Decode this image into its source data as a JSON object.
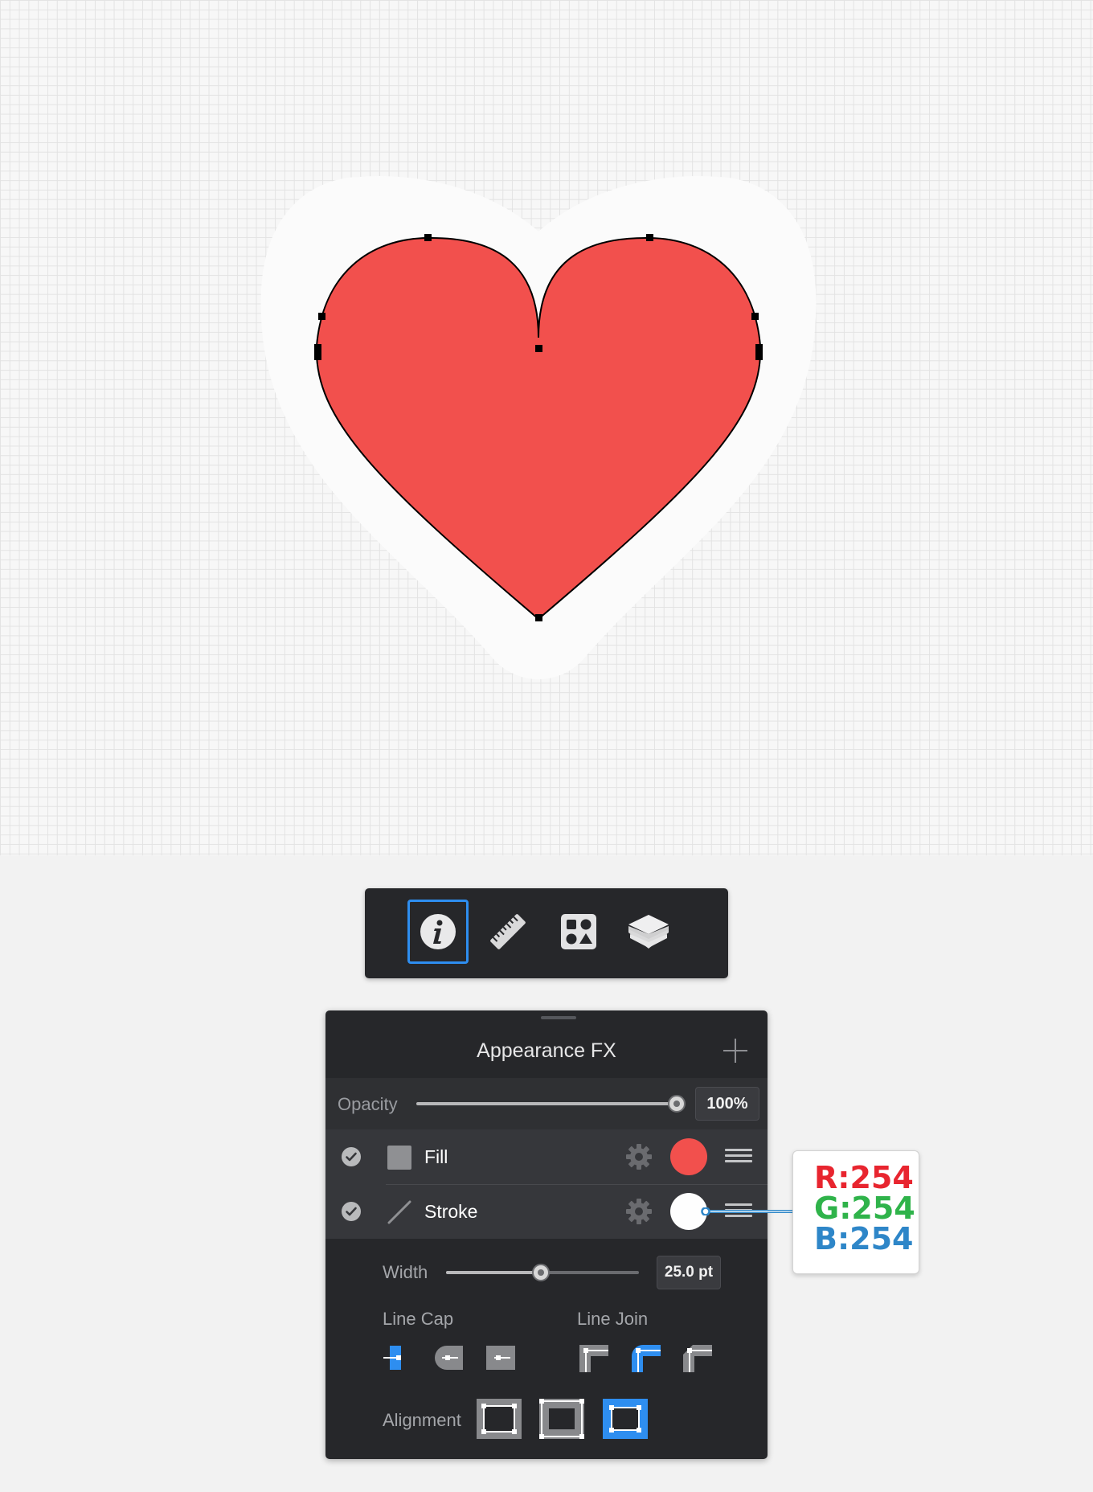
{
  "toolbar": {
    "tabs": [
      {
        "name": "info",
        "icon": "info-icon",
        "active": true
      },
      {
        "name": "ruler",
        "icon": "ruler-icon",
        "active": false
      },
      {
        "name": "shapes",
        "icon": "shapes-icon",
        "active": false
      },
      {
        "name": "layers",
        "icon": "layers-icon",
        "active": false
      }
    ]
  },
  "panel": {
    "title": "Appearance FX",
    "opacity": {
      "label": "Opacity",
      "value": "100%",
      "level": 1.0
    },
    "fill": {
      "label": "Fill",
      "enabled": true,
      "color": "#f2504d"
    },
    "stroke": {
      "label": "Stroke",
      "enabled": true,
      "color": "#fefefe"
    },
    "width": {
      "label": "Width",
      "value": "25.0 pt",
      "level": 0.5
    },
    "line_cap": {
      "label": "Line Cap",
      "options": [
        "butt-cap",
        "round-cap",
        "square-cap"
      ],
      "selected": "butt-cap"
    },
    "line_join": {
      "label": "Line Join",
      "options": [
        "miter-join",
        "round-join",
        "bevel-join"
      ],
      "selected": "round-join"
    },
    "alignment": {
      "label": "Alignment",
      "options": [
        "inside",
        "center",
        "outside"
      ],
      "selected": "outside"
    }
  },
  "callout": {
    "r": "R:254",
    "g": "G:254",
    "b": "B:254",
    "colors": {
      "r": "#e8252f",
      "g": "#2fb34a",
      "b": "#2e86c8"
    }
  },
  "colors": {
    "accent": "#2e8ef0",
    "heart": "#f2504d",
    "panel_bg": "#26272a"
  }
}
